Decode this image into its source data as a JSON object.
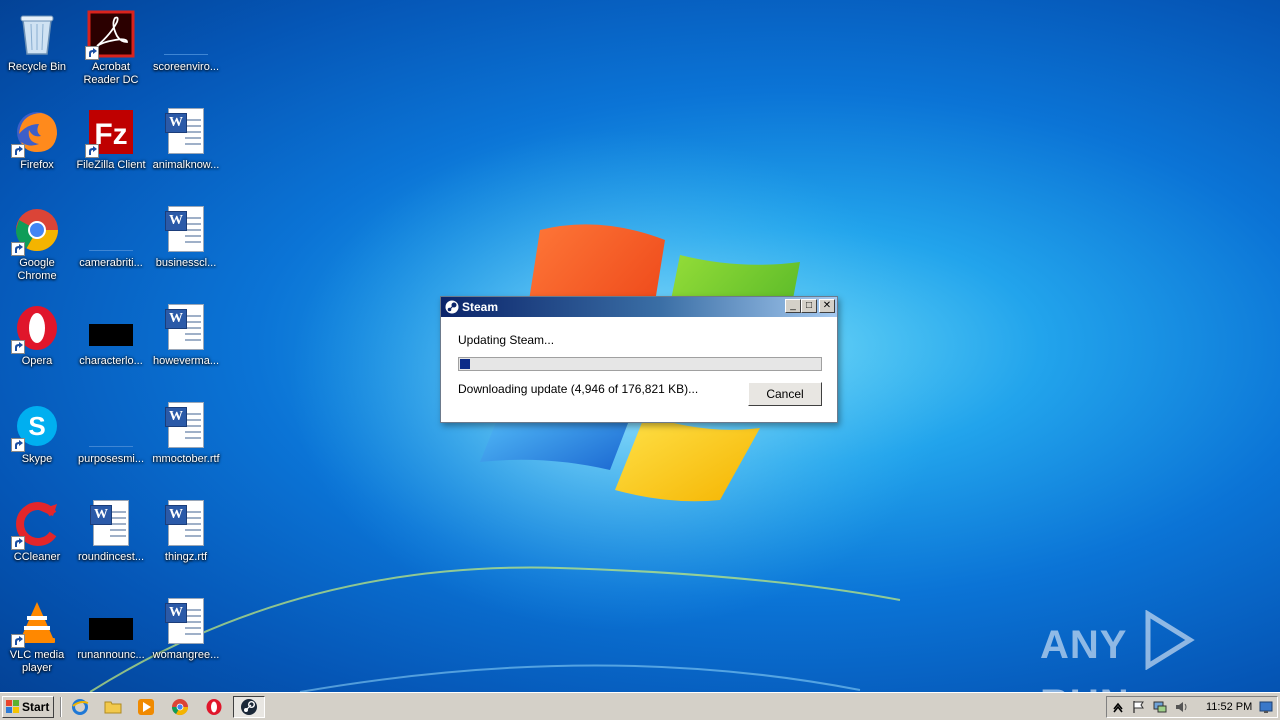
{
  "desktop_icons": [
    {
      "label": "Recycle Bin",
      "icon": "recycle-bin-icon"
    },
    {
      "label": "Acrobat Reader DC",
      "icon": "acrobat-reader-icon"
    },
    {
      "label": "scoreenviro...",
      "icon": "file-thumbnail-icon"
    },
    {
      "label": "Firefox",
      "icon": "firefox-icon"
    },
    {
      "label": "FileZilla Client",
      "icon": "filezilla-icon"
    },
    {
      "label": "animalknow...",
      "icon": "word-document-icon"
    },
    {
      "label": "Google Chrome",
      "icon": "chrome-icon"
    },
    {
      "label": "camerabriti...",
      "icon": "file-thumbnail-icon"
    },
    {
      "label": "businesscl...",
      "icon": "word-document-icon"
    },
    {
      "label": "Opera",
      "icon": "opera-icon"
    },
    {
      "label": "characterlo...",
      "icon": "black-thumbnail-icon"
    },
    {
      "label": "howeverma...",
      "icon": "word-document-icon"
    },
    {
      "label": "Skype",
      "icon": "skype-icon"
    },
    {
      "label": "purposesmi...",
      "icon": "file-thumbnail-icon"
    },
    {
      "label": "mmoctober.rtf",
      "icon": "word-document-icon"
    },
    {
      "label": "CCleaner",
      "icon": "ccleaner-icon"
    },
    {
      "label": "roundincest...",
      "icon": "word-document-icon"
    },
    {
      "label": "thingz.rtf",
      "icon": "word-document-icon"
    },
    {
      "label": "VLC media player",
      "icon": "vlc-icon"
    },
    {
      "label": "runannounc...",
      "icon": "black-thumbnail-icon"
    },
    {
      "label": "womangree...",
      "icon": "word-document-icon"
    }
  ],
  "dialog": {
    "title": "Steam",
    "status": "Updating Steam...",
    "progress_fraction": 0.028,
    "detail": "Downloading update (4,946 of 176,821 KB)...",
    "cancel_label": "Cancel",
    "minimize_glyph": "_",
    "maximize_glyph": "□",
    "close_glyph": "✕"
  },
  "watermark": {
    "left": "ANY",
    "right": "RUN"
  },
  "taskbar": {
    "start_label": "Start",
    "quick_launch": [
      "internet-explorer-icon",
      "folder-icon",
      "media-player-icon",
      "chrome-icon",
      "opera-icon"
    ],
    "active_task": "steam-icon",
    "clock": "11:52 PM",
    "tray_icons": [
      "show-hidden-icon",
      "action-center-flag-icon",
      "network-icon",
      "volume-icon",
      "desktop-icon"
    ]
  },
  "colors": {
    "titlebar_start": "#0b246a",
    "titlebar_end": "#a6caf0",
    "progress_fill": "#0d2c88",
    "taskbar": "#d4d0c8"
  }
}
